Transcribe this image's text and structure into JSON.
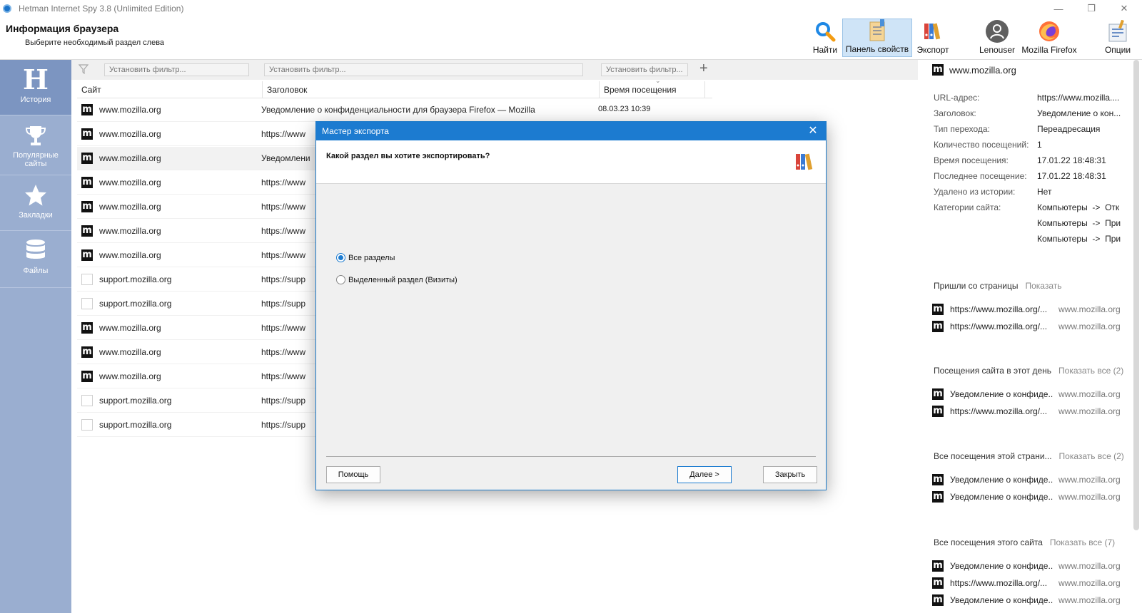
{
  "window": {
    "title": "Hetman Internet Spy 3.8 (Unlimited Edition)",
    "controls": {
      "minimize": "—",
      "restore": "❐",
      "close": "✕"
    }
  },
  "header": {
    "title": "Информация браузера",
    "subtitle": "Выберите необходимый раздел слева"
  },
  "toolbar": {
    "find": "Найти",
    "properties": "Панель свойств",
    "export": "Экспорт",
    "user": "Lenouser",
    "browser": "Mozilla Firefox",
    "options": "Опции"
  },
  "nav": {
    "history": "История",
    "popular_1": "Популярные",
    "popular_2": "сайты",
    "bookmarks": "Закладки",
    "files": "Файлы"
  },
  "filters": {
    "placeholder": "Установить фильтр...",
    "add": "+"
  },
  "table": {
    "columns": {
      "site": "Сайт",
      "title": "Заголовок",
      "time": "Время посещения"
    },
    "rows": [
      {
        "site": "www.mozilla.org",
        "title": "Уведомление о конфиденциальности для браузера Firefox — Mozilla",
        "time": "08.03.23 10:39"
      },
      {
        "site": "www.mozilla.org",
        "title": "https://www",
        "time": ""
      },
      {
        "site": "www.mozilla.org",
        "title": "Уведомлени",
        "time": ""
      },
      {
        "site": "www.mozilla.org",
        "title": "https://www",
        "time": ""
      },
      {
        "site": "www.mozilla.org",
        "title": "https://www",
        "time": ""
      },
      {
        "site": "www.mozilla.org",
        "title": "https://www",
        "time": ""
      },
      {
        "site": "www.mozilla.org",
        "title": "https://www",
        "time": ""
      },
      {
        "site": "support.mozilla.org",
        "title": "https://supp",
        "time": ""
      },
      {
        "site": "support.mozilla.org",
        "title": "https://supp",
        "time": ""
      },
      {
        "site": "www.mozilla.org",
        "title": "https://www",
        "time": ""
      },
      {
        "site": "www.mozilla.org",
        "title": "https://www",
        "time": ""
      },
      {
        "site": "www.mozilla.org",
        "title": "https://www",
        "time": ""
      },
      {
        "site": "support.mozilla.org",
        "title": "https://supp",
        "time": ""
      },
      {
        "site": "support.mozilla.org",
        "title": "https://supp",
        "time": ""
      }
    ]
  },
  "panel": {
    "site": "www.mozilla.org",
    "props": [
      {
        "label": "URL-адрес:",
        "value": "https://www.mozilla...."
      },
      {
        "label": "Заголовок:",
        "value": "Уведомление о кон..."
      },
      {
        "label": "Тип перехода:",
        "value": "Переадресация"
      },
      {
        "label": "Количество посещений:",
        "value": "1"
      },
      {
        "label": "Время посещения:",
        "value": "17.01.22 18:48:31"
      },
      {
        "label": "Последнее посещение:",
        "value": "17.01.22 18:48:31"
      },
      {
        "label": "Удалено из истории:",
        "value": "Нет"
      },
      {
        "label": "Категории сайта:",
        "value": "Компьютеры  ->  Отк"
      }
    ],
    "categories_extra": [
      "Компьютеры  ->  При",
      "Компьютеры  ->  При"
    ],
    "sections": [
      {
        "title": "Пришли со страницы",
        "link": "Показать",
        "items": [
          {
            "text": "https://www.mozilla.org/...",
            "domain": "www.mozilla.org"
          },
          {
            "text": "https://www.mozilla.org/...",
            "domain": "www.mozilla.org"
          }
        ]
      },
      {
        "title": "Посещения сайта в этот день",
        "link": "Показать все (2)",
        "items": [
          {
            "text": "Уведомление о конфиде...",
            "domain": "www.mozilla.org"
          },
          {
            "text": "https://www.mozilla.org/...",
            "domain": "www.mozilla.org"
          }
        ]
      },
      {
        "title": "Все посещения этой страни...",
        "link": "Показать все (2)",
        "items": [
          {
            "text": "Уведомление о конфиде...",
            "domain": "www.mozilla.org"
          },
          {
            "text": "Уведомление о конфиде...",
            "domain": "www.mozilla.org"
          }
        ]
      },
      {
        "title": "Все посещения этого сайта",
        "link": "Показать все (7)",
        "items": [
          {
            "text": "Уведомление о конфиде...",
            "domain": "www.mozilla.org"
          },
          {
            "text": "https://www.mozilla.org/...",
            "domain": "www.mozilla.org"
          },
          {
            "text": "Уведомление о конфиде...",
            "domain": "www.mozilla.org"
          }
        ]
      }
    ]
  },
  "modal": {
    "title": "Мастер экспорта",
    "close": "✕",
    "question": "Какой раздел вы хотите экспортировать?",
    "option_all": "Все разделы",
    "option_selected": "Выделенный раздел (Визиты)",
    "help": "Помощь",
    "next": "Далее >",
    "close_btn": "Закрыть"
  },
  "colors": {
    "accent": "#1c7bd0",
    "nav_bg": "#9aaed0",
    "nav_active": "#7c95c1",
    "toolbar_active": "#cfe4f7"
  },
  "icons": {
    "find": "magnifier-icon",
    "properties": "properties-panel-icon",
    "export": "export-binders-icon",
    "user": "user-avatar-icon",
    "browser": "firefox-icon",
    "options": "options-icon"
  }
}
